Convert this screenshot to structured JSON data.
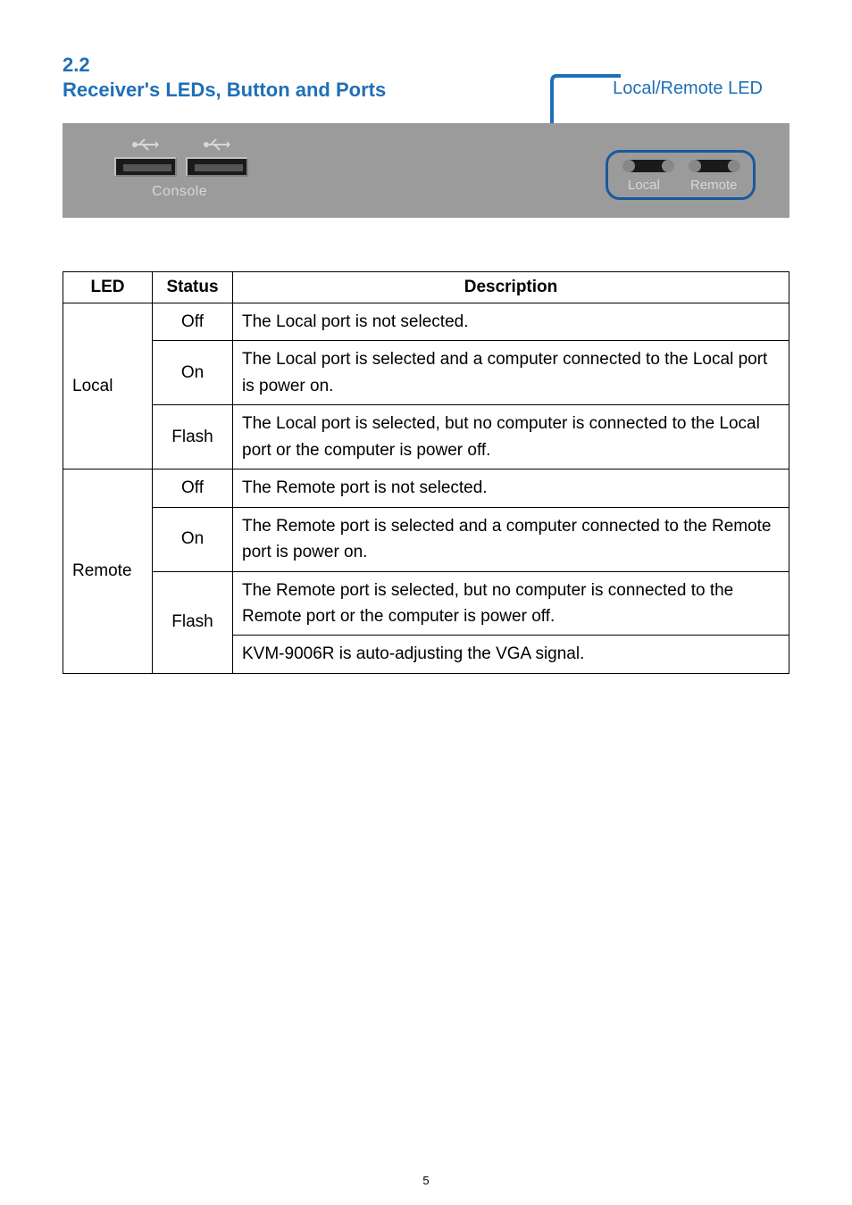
{
  "section": {
    "number": "2.2",
    "title": "Receiver's LEDs, Button and Ports",
    "callout": "Local/Remote LED"
  },
  "panel": {
    "consoleLabel": "Console",
    "localLabel": "Local",
    "remoteLabel": "Remote"
  },
  "table": {
    "headers": {
      "led": "LED",
      "status": "Status",
      "description": "Description"
    },
    "rows": [
      {
        "led": "Local",
        "status": "Off",
        "desc": "The Local port is not selected."
      },
      {
        "led": "",
        "status": "On",
        "desc": "The Local port is selected and a computer connected to the Local port is power on."
      },
      {
        "led": "",
        "status": "Flash",
        "desc": "The Local port is selected, but no computer is connected to the Local port or the computer is power off."
      },
      {
        "led": "Remote",
        "status": "Off",
        "desc": "The Remote port is not selected."
      },
      {
        "led": "",
        "status": "On",
        "desc": "The Remote port is selected and a computer connected to the Remote port is power on."
      },
      {
        "led": "",
        "status": "Flash",
        "desc": "The Remote port is selected, but no computer is connected to the Remote port or the computer is power off."
      },
      {
        "led": "",
        "status": "",
        "desc": "KVM-9006R is auto-adjusting the VGA signal."
      }
    ]
  },
  "pageNumber": "5"
}
